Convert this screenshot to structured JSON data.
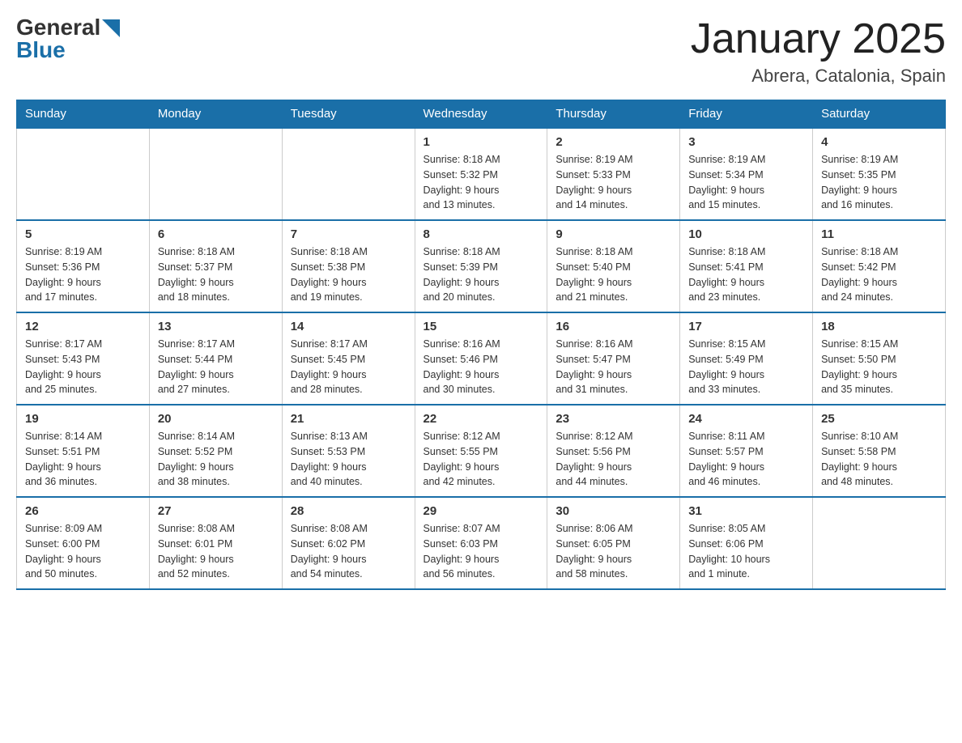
{
  "logo": {
    "general": "General",
    "blue": "Blue"
  },
  "header": {
    "title": "January 2025",
    "location": "Abrera, Catalonia, Spain"
  },
  "days_of_week": [
    "Sunday",
    "Monday",
    "Tuesday",
    "Wednesday",
    "Thursday",
    "Friday",
    "Saturday"
  ],
  "weeks": [
    [
      {
        "day": "",
        "info": ""
      },
      {
        "day": "",
        "info": ""
      },
      {
        "day": "",
        "info": ""
      },
      {
        "day": "1",
        "info": "Sunrise: 8:18 AM\nSunset: 5:32 PM\nDaylight: 9 hours\nand 13 minutes."
      },
      {
        "day": "2",
        "info": "Sunrise: 8:19 AM\nSunset: 5:33 PM\nDaylight: 9 hours\nand 14 minutes."
      },
      {
        "day": "3",
        "info": "Sunrise: 8:19 AM\nSunset: 5:34 PM\nDaylight: 9 hours\nand 15 minutes."
      },
      {
        "day": "4",
        "info": "Sunrise: 8:19 AM\nSunset: 5:35 PM\nDaylight: 9 hours\nand 16 minutes."
      }
    ],
    [
      {
        "day": "5",
        "info": "Sunrise: 8:19 AM\nSunset: 5:36 PM\nDaylight: 9 hours\nand 17 minutes."
      },
      {
        "day": "6",
        "info": "Sunrise: 8:18 AM\nSunset: 5:37 PM\nDaylight: 9 hours\nand 18 minutes."
      },
      {
        "day": "7",
        "info": "Sunrise: 8:18 AM\nSunset: 5:38 PM\nDaylight: 9 hours\nand 19 minutes."
      },
      {
        "day": "8",
        "info": "Sunrise: 8:18 AM\nSunset: 5:39 PM\nDaylight: 9 hours\nand 20 minutes."
      },
      {
        "day": "9",
        "info": "Sunrise: 8:18 AM\nSunset: 5:40 PM\nDaylight: 9 hours\nand 21 minutes."
      },
      {
        "day": "10",
        "info": "Sunrise: 8:18 AM\nSunset: 5:41 PM\nDaylight: 9 hours\nand 23 minutes."
      },
      {
        "day": "11",
        "info": "Sunrise: 8:18 AM\nSunset: 5:42 PM\nDaylight: 9 hours\nand 24 minutes."
      }
    ],
    [
      {
        "day": "12",
        "info": "Sunrise: 8:17 AM\nSunset: 5:43 PM\nDaylight: 9 hours\nand 25 minutes."
      },
      {
        "day": "13",
        "info": "Sunrise: 8:17 AM\nSunset: 5:44 PM\nDaylight: 9 hours\nand 27 minutes."
      },
      {
        "day": "14",
        "info": "Sunrise: 8:17 AM\nSunset: 5:45 PM\nDaylight: 9 hours\nand 28 minutes."
      },
      {
        "day": "15",
        "info": "Sunrise: 8:16 AM\nSunset: 5:46 PM\nDaylight: 9 hours\nand 30 minutes."
      },
      {
        "day": "16",
        "info": "Sunrise: 8:16 AM\nSunset: 5:47 PM\nDaylight: 9 hours\nand 31 minutes."
      },
      {
        "day": "17",
        "info": "Sunrise: 8:15 AM\nSunset: 5:49 PM\nDaylight: 9 hours\nand 33 minutes."
      },
      {
        "day": "18",
        "info": "Sunrise: 8:15 AM\nSunset: 5:50 PM\nDaylight: 9 hours\nand 35 minutes."
      }
    ],
    [
      {
        "day": "19",
        "info": "Sunrise: 8:14 AM\nSunset: 5:51 PM\nDaylight: 9 hours\nand 36 minutes."
      },
      {
        "day": "20",
        "info": "Sunrise: 8:14 AM\nSunset: 5:52 PM\nDaylight: 9 hours\nand 38 minutes."
      },
      {
        "day": "21",
        "info": "Sunrise: 8:13 AM\nSunset: 5:53 PM\nDaylight: 9 hours\nand 40 minutes."
      },
      {
        "day": "22",
        "info": "Sunrise: 8:12 AM\nSunset: 5:55 PM\nDaylight: 9 hours\nand 42 minutes."
      },
      {
        "day": "23",
        "info": "Sunrise: 8:12 AM\nSunset: 5:56 PM\nDaylight: 9 hours\nand 44 minutes."
      },
      {
        "day": "24",
        "info": "Sunrise: 8:11 AM\nSunset: 5:57 PM\nDaylight: 9 hours\nand 46 minutes."
      },
      {
        "day": "25",
        "info": "Sunrise: 8:10 AM\nSunset: 5:58 PM\nDaylight: 9 hours\nand 48 minutes."
      }
    ],
    [
      {
        "day": "26",
        "info": "Sunrise: 8:09 AM\nSunset: 6:00 PM\nDaylight: 9 hours\nand 50 minutes."
      },
      {
        "day": "27",
        "info": "Sunrise: 8:08 AM\nSunset: 6:01 PM\nDaylight: 9 hours\nand 52 minutes."
      },
      {
        "day": "28",
        "info": "Sunrise: 8:08 AM\nSunset: 6:02 PM\nDaylight: 9 hours\nand 54 minutes."
      },
      {
        "day": "29",
        "info": "Sunrise: 8:07 AM\nSunset: 6:03 PM\nDaylight: 9 hours\nand 56 minutes."
      },
      {
        "day": "30",
        "info": "Sunrise: 8:06 AM\nSunset: 6:05 PM\nDaylight: 9 hours\nand 58 minutes."
      },
      {
        "day": "31",
        "info": "Sunrise: 8:05 AM\nSunset: 6:06 PM\nDaylight: 10 hours\nand 1 minute."
      },
      {
        "day": "",
        "info": ""
      }
    ]
  ]
}
